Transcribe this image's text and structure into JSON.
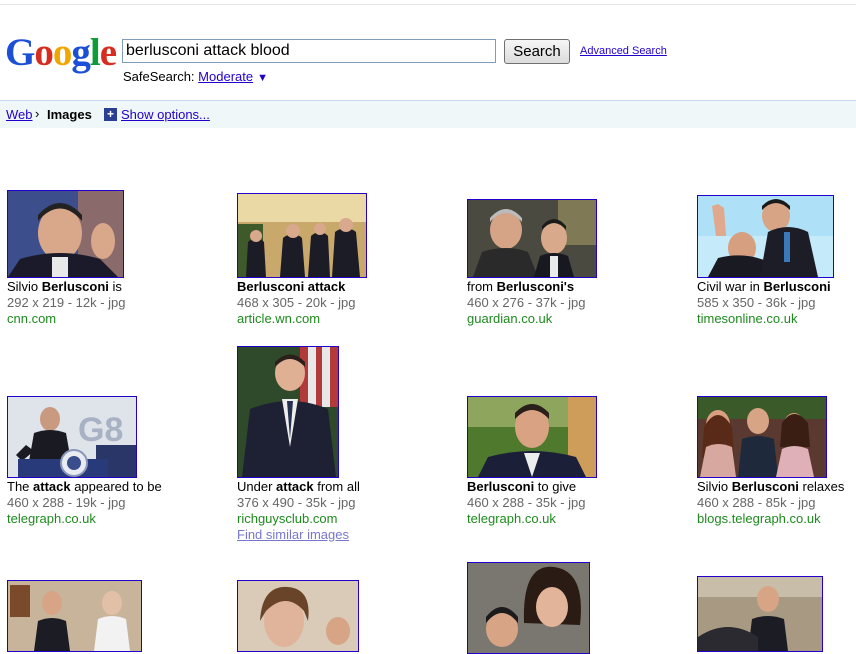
{
  "logo": {
    "letters": [
      "G",
      "o",
      "o",
      "g",
      "l",
      "e"
    ]
  },
  "search": {
    "query": "berlusconi attack blood",
    "button_label": "Search",
    "advanced_label": "Advanced Search"
  },
  "safesearch": {
    "label": "SafeSearch:",
    "value": "Moderate",
    "arrow": "▼"
  },
  "nav": {
    "web": "Web",
    "separator": "›",
    "current": "Images",
    "plus": "+",
    "show_options": "Show options..."
  },
  "results": [
    {
      "caption_pre": "Silvio ",
      "caption_bold": "Berlusconi",
      "caption_post": " is",
      "dims": "292 x 219 - 12k - jpg",
      "site": "cnn.com"
    },
    {
      "caption_pre": "",
      "caption_bold": "Berlusconi attack",
      "caption_post": "",
      "dims": "468 x 305 - 20k - jpg",
      "site": "article.wn.com"
    },
    {
      "caption_pre": "from ",
      "caption_bold": "Berlusconi's",
      "caption_post": "",
      "dims": "460 x 276 - 37k - jpg",
      "site": "guardian.co.uk"
    },
    {
      "caption_pre": "Civil war in ",
      "caption_bold": "Berlusconi",
      "caption_post": "",
      "dims": "585 x 350 - 36k - jpg",
      "site": "timesonline.co.uk"
    },
    {
      "caption_pre": "The ",
      "caption_bold": "attack",
      "caption_post": " appeared to be",
      "dims": "460 x 288 - 19k - jpg",
      "site": "telegraph.co.uk"
    },
    {
      "caption_pre": "Under ",
      "caption_bold": "attack",
      "caption_post": " from all",
      "dims": "376 x 490 - 35k - jpg",
      "site": "richguysclub.com",
      "similar": "Find similar images"
    },
    {
      "caption_pre": "",
      "caption_bold": "Berlusconi",
      "caption_post": " to give",
      "dims": "460 x 288 - 35k - jpg",
      "site": "telegraph.co.uk"
    },
    {
      "caption_pre": "Silvio ",
      "caption_bold": "Berlusconi",
      "caption_post": " relaxes",
      "dims": "460 x 288 - 85k - jpg",
      "site": "blogs.telegraph.co.uk"
    }
  ]
}
